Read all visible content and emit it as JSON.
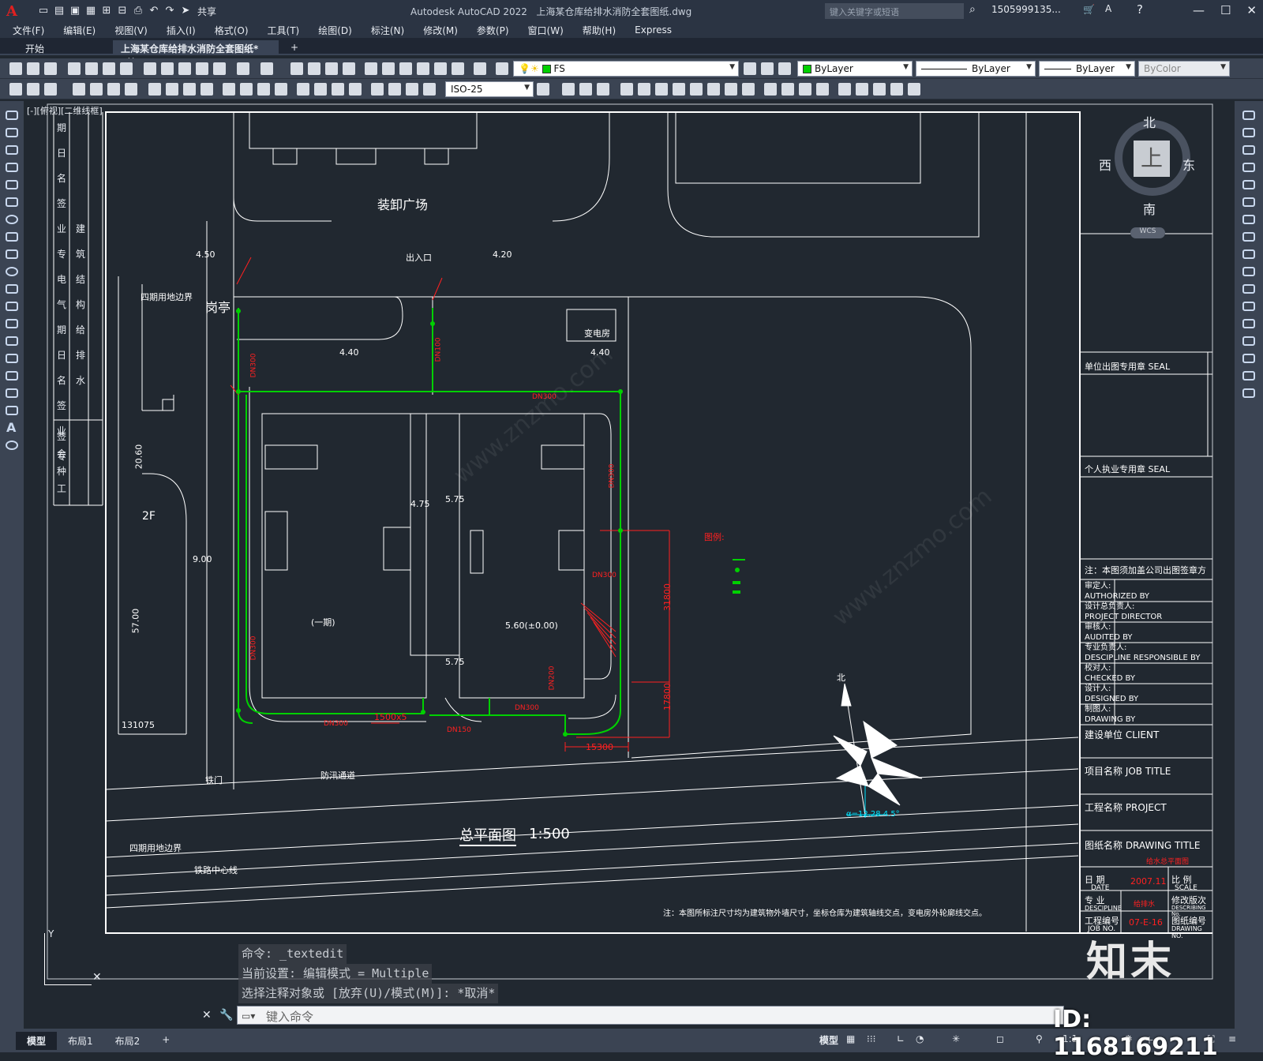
{
  "app": {
    "title": "Autodesk AutoCAD 2022",
    "document": "上海某仓库给排水消防全套图纸.dwg",
    "logo": "A",
    "share": "共享",
    "search_placeholder": "键入关键字或短语",
    "user": "1505999135...",
    "window_controls": [
      "—",
      "☐",
      "✕"
    ]
  },
  "menu": [
    "文件(F)",
    "编辑(E)",
    "视图(V)",
    "插入(I)",
    "格式(O)",
    "工具(T)",
    "绘图(D)",
    "标注(N)",
    "修改(M)",
    "参数(P)",
    "窗口(W)",
    "帮助(H)",
    "Express"
  ],
  "file_tabs": {
    "start": "开始",
    "active": "上海某仓库给排水消防全套图纸*",
    "close": "✕",
    "add": "+"
  },
  "toolbar": {
    "layer": "FS",
    "color": "ByLayer",
    "linetype": "ByLayer",
    "lineweight": "ByLayer",
    "plotstyle": "ByColor",
    "dimstyle": "ISO-25"
  },
  "viewport_label": "[-][俯视][二维线框]",
  "viewcube": {
    "north": "北",
    "south": "南",
    "east": "东",
    "west": "西",
    "top": "上",
    "wcs": "WCS"
  },
  "drawing": {
    "labels": {
      "loading_plaza": "装卸广场",
      "gate_in": "出入口",
      "guard": "岗亭",
      "boundary_4": "四期用地边界",
      "elev_450": "4.50",
      "elev_420": "4.20",
      "elev_440": "4.40",
      "elev_440b": "4.40",
      "substation": "变电房",
      "phase1": "(一期)",
      "elev_560": "5.60(±0.00)",
      "elev_475": "4.75",
      "elev_575": "5.75",
      "elev_575b": "5.75",
      "legend": "图例:",
      "iron_gate": "铁门",
      "flood_channel": "防汛通道",
      "rail_center": "铁路中心线",
      "boundary_4b": "四期用地边界",
      "site_plan": "总平面图",
      "scale": "1:500",
      "note": "注：本图所标注尺寸均为建筑物外墙尺寸，坐标仓库为建筑轴线交点，变电房外轮廓线交点。",
      "dim_2f": "2F",
      "dim_2060": "20.60",
      "dim_900": "9.00",
      "dim_5700": "57.00",
      "dim_1310": "131075",
      "dim_15300": "15300",
      "dim_31800": "31800",
      "dim_17800": "17800",
      "dim_1500x5": "1500x5",
      "north": "北",
      "angle": "α=12.28 4.5°",
      "pipes": [
        "DN300",
        "DN100",
        "DN300",
        "DN300",
        "DN300",
        "DN300",
        "DN300",
        "DN200",
        "DN300",
        "DN150"
      ]
    },
    "left_strip": [
      "期",
      "日",
      "名",
      "签",
      "业",
      "专",
      "电",
      "气",
      "期",
      "日",
      "名",
      "签",
      "业",
      "专",
      "建",
      "筑",
      "结",
      "构",
      "给",
      "排",
      "水",
      "签",
      "会",
      "种",
      "工"
    ]
  },
  "titleblock": {
    "seal_unit": "单位出图专用章 SEAL",
    "seal_personal": "个人执业专用章 SEAL",
    "note": "注：本图须加盖公司出图签章方",
    "rows": [
      {
        "cn": "审定人:",
        "en": "AUTHORIZED BY"
      },
      {
        "cn": "设计总负责人:",
        "en": "PROJECT DIRECTOR"
      },
      {
        "cn": "审核人:",
        "en": "AUDITED BY"
      },
      {
        "cn": "专业负责人:",
        "en": "DESCIPLINE RESPONSIBLE BY"
      },
      {
        "cn": "校对人:",
        "en": "CHECKED BY"
      },
      {
        "cn": "设计人:",
        "en": "DESIGNED BY"
      },
      {
        "cn": "制图人:",
        "en": "DRAWING BY"
      }
    ],
    "client": "建设单位 CLIENT",
    "job_title": "项目名称 JOB TITLE",
    "project": "工程名称 PROJECT",
    "drawing_title": "图纸名称 DRAWING TITLE",
    "drawing_title_val": "给水总平面图",
    "date": "日 期",
    "date_en": "DATE",
    "date_val": "2007.11",
    "scale": "比 例",
    "scale_en": "SCALE",
    "discipline": "专 业",
    "discipline_en": "DESCIPLINE",
    "discipline_val": "给排水",
    "revision": "修改版次",
    "revision_en": "DESCRIBING No.",
    "job_no": "工程编号",
    "job_no_en": "JOB NO.",
    "job_no_val": "07-E-16",
    "drawing_no": "图纸编号",
    "drawing_no_en": "DRAWING NO."
  },
  "command": {
    "history": [
      "命令:  _textedit",
      "当前设置: 编辑模式 = Multiple",
      "选择注释对象或 [放弃(U)/模式(M)]: *取消*"
    ],
    "placeholder": "键入命令"
  },
  "layout_tabs": [
    "模型",
    "布局1",
    "布局2"
  ],
  "status": {
    "model": "模型",
    "scale": "1:1"
  },
  "watermark": {
    "brand": "知末",
    "id": "ID: 1168169211",
    "text": "www.znzmo.com"
  },
  "colors": {
    "canvas": "#212830",
    "line": "#ffffff",
    "pipe": "#00d000",
    "annot": "#ff2020",
    "cyan": "#00e5ff"
  }
}
